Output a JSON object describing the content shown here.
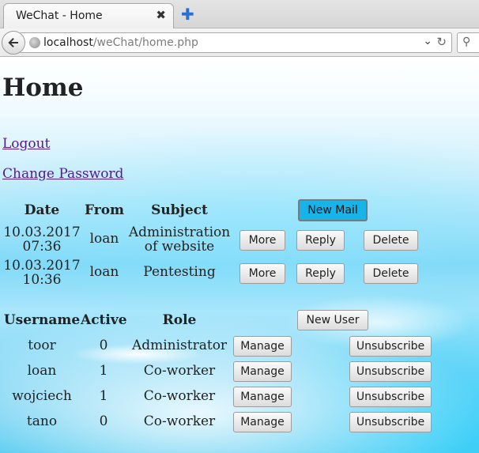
{
  "browser": {
    "tab_title": "WeChat - Home",
    "tab_close": "✖",
    "new_tab": "✚",
    "url_host": "localhost",
    "url_path": "/weChat/home.php",
    "url_dropdown": "⌄",
    "url_reload": "↻",
    "search_icon": "⚲"
  },
  "page": {
    "title": "Home",
    "logout_link": "Logout",
    "change_password_link": "Change Password"
  },
  "mail": {
    "headers": {
      "date": "Date",
      "from": "From",
      "subject": "Subject"
    },
    "new_mail_button": "New Mail",
    "rows": [
      {
        "date_line1": "10.03.2017",
        "date_line2": "07:36",
        "from": "loan",
        "subject_line1": "Administration",
        "subject_line2": "of website",
        "more": "More",
        "reply": "Reply",
        "delete": "Delete"
      },
      {
        "date_line1": "10.03.2017",
        "date_line2": "10:36",
        "from": "loan",
        "subject_line1": "Pentesting",
        "subject_line2": "",
        "more": "More",
        "reply": "Reply",
        "delete": "Delete"
      }
    ]
  },
  "users": {
    "headers": {
      "username": "Username",
      "active": "Active",
      "role": "Role"
    },
    "new_user_button": "New User",
    "rows": [
      {
        "username": "toor",
        "active": "0",
        "role": "Administrator",
        "manage": "Manage",
        "unsubscribe": "Unsubscribe"
      },
      {
        "username": "loan",
        "active": "1",
        "role": "Co-worker",
        "manage": "Manage",
        "unsubscribe": "Unsubscribe"
      },
      {
        "username": "wojciech",
        "active": "1",
        "role": "Co-worker",
        "manage": "Manage",
        "unsubscribe": "Unsubscribe"
      },
      {
        "username": "tano",
        "active": "0",
        "role": "Co-worker",
        "manage": "Manage",
        "unsubscribe": "Unsubscribe"
      }
    ]
  },
  "colors": {
    "accent": "#16b4e8",
    "link": "#551a8b",
    "background_blue": "#3fc4ee"
  }
}
